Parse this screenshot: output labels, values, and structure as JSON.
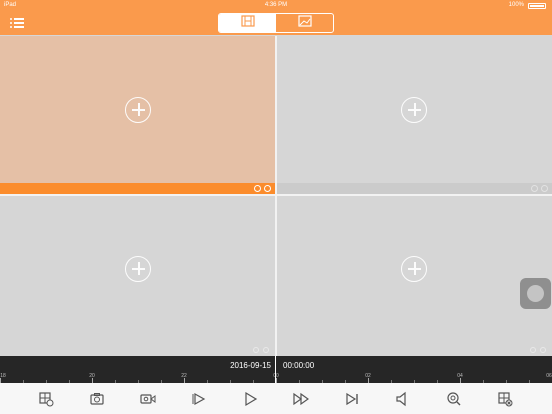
{
  "status_bar": {
    "carrier": "iPad",
    "time": "4:36 PM",
    "battery": "100%"
  },
  "header": {
    "menu_icon": "list-icon",
    "segments": [
      {
        "icon": "film-strip-icon",
        "active": true
      },
      {
        "icon": "image-gallery-icon",
        "active": false
      }
    ],
    "accent_color": "#fa9a4c"
  },
  "grid": {
    "cells": [
      {
        "selected": true,
        "icon": "add-channel-icon"
      },
      {
        "selected": false,
        "icon": "add-channel-icon"
      },
      {
        "selected": false,
        "icon": "add-channel-icon"
      },
      {
        "selected": false,
        "icon": "add-channel-icon"
      }
    ],
    "selected_color": "#fb8c2c"
  },
  "timeline": {
    "date": "2016-09-15",
    "time": "00:00:00",
    "ticks": [
      "18",
      "20",
      "22",
      "00",
      "02",
      "04",
      "06"
    ]
  },
  "toolbar": {
    "buttons": [
      "playback-search-icon",
      "snapshot-icon",
      "record-icon",
      "slow-play-icon",
      "play-icon",
      "fast-forward-icon",
      "next-frame-icon",
      "volume-icon",
      "digital-zoom-icon",
      "close-all-icon"
    ]
  }
}
